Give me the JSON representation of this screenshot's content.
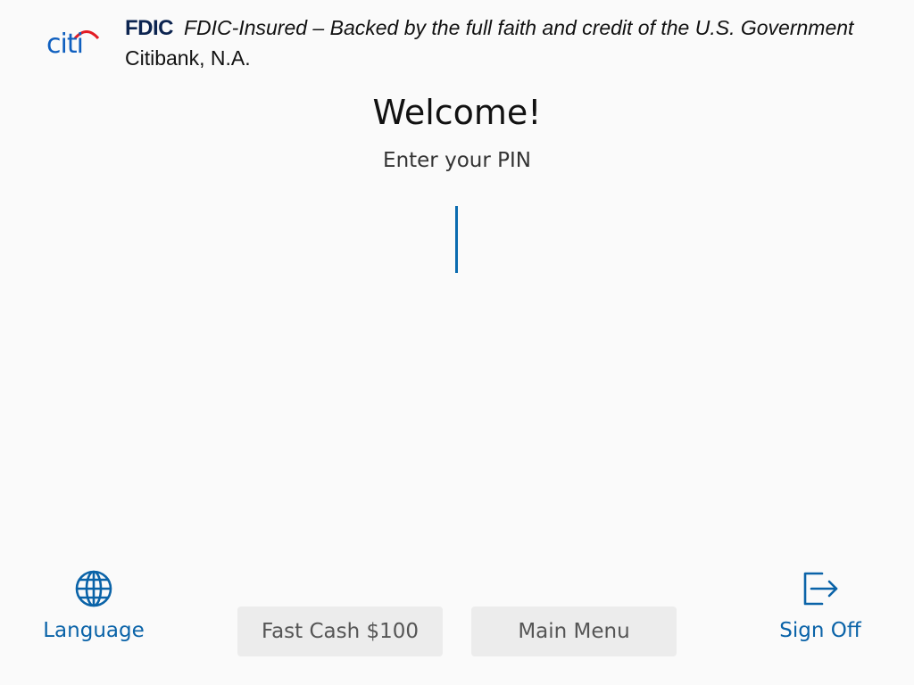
{
  "header": {
    "logo_text": "citi",
    "fdic_mark": "FDIC",
    "fdic_statement": "FDIC-Insured – Backed by the full faith and credit of the U.S. Government",
    "bank_name": "Citibank, N.A."
  },
  "main": {
    "title": "Welcome!",
    "prompt": "Enter your PIN",
    "pin_value": ""
  },
  "footer": {
    "language_label": "Language",
    "fast_cash_label": "Fast Cash $100",
    "main_menu_label": "Main Menu",
    "sign_off_label": "Sign Off",
    "language_icon": "globe-icon",
    "sign_off_icon": "exit-icon"
  },
  "colors": {
    "background": "#fafafa",
    "accent_blue": "#0a63a8",
    "citi_blue": "#0f5fbf",
    "citi_arc_red": "#e31b23",
    "fdic_navy": "#0c2450",
    "pill_gray": "#ececec"
  }
}
